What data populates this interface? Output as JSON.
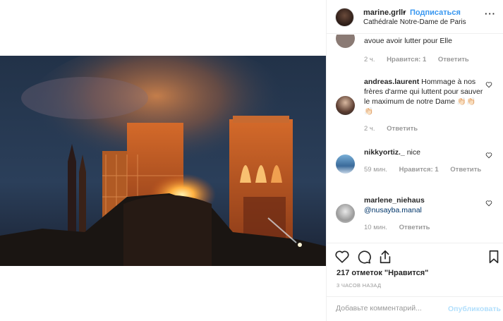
{
  "header": {
    "username": "marine.grllr",
    "separator": "•",
    "follow_label": "Подписаться",
    "location": "Cathédrale Notre-Dame de Paris",
    "more_label": "···"
  },
  "comments": [
    {
      "text": "avoue avoir lutter pour Elle",
      "time": "2 ч.",
      "likes": "Нравится: 1",
      "reply": "Ответить"
    },
    {
      "username": "andreas.laurent",
      "text": "Hommage à nos frères d'arme qui luttent pour sauver le maximum de notre Dame 👏🏻👏🏻👏🏻",
      "time": "2 ч.",
      "reply": "Ответить"
    },
    {
      "username": "nikkyortiz._",
      "text": "nice",
      "time": "59 мин.",
      "likes": "Нравится: 1",
      "reply": "Ответить"
    },
    {
      "username": "marlene_niehaus",
      "mention": "@nusayba.manal",
      "time": "10 мин.",
      "reply": "Ответить"
    }
  ],
  "post": {
    "likes_text": "217 отметок \"Нравится\"",
    "posted_ago": "3 ЧАСОВ НАЗАД"
  },
  "add_comment": {
    "placeholder": "Добавьте комментарий...",
    "publish_label": "Опубликовать"
  },
  "icons": {
    "like": "heart-icon",
    "comment": "comment-bubble-icon",
    "share": "share-icon",
    "save": "bookmark-icon"
  },
  "colors": {
    "accent": "#3897f0",
    "publish_disabled": "#b2dffc",
    "mention": "#003569",
    "muted": "#999999"
  }
}
